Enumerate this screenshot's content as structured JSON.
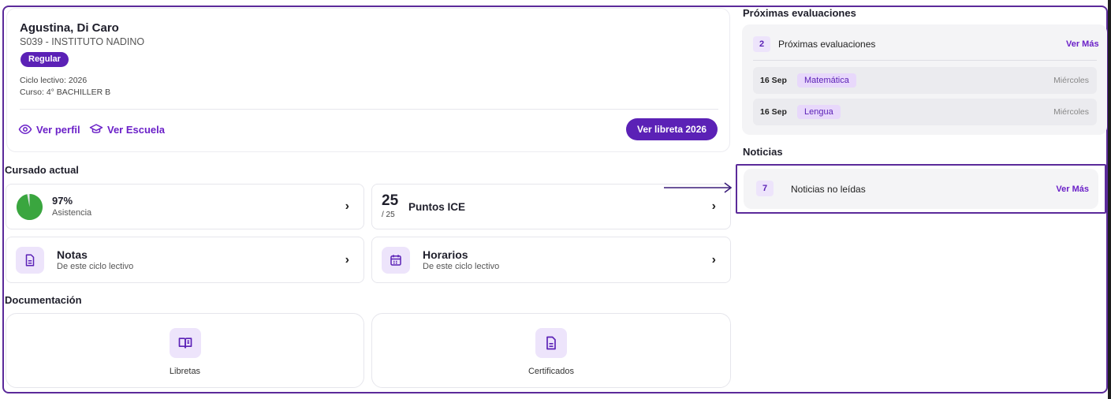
{
  "student": {
    "name": "Agustina, Di Caro",
    "school": "S039 - INSTITUTO NADINO",
    "status_badge": "Regular",
    "ciclo": "Ciclo lectivo: 2026",
    "curso": "Curso: 4° BACHILLER B",
    "link_profile": "Ver perfil",
    "link_school": "Ver Escuela",
    "btn_libreta": "Ver libreta 2026"
  },
  "cursado": {
    "title": "Cursado actual",
    "attendance": {
      "value": "97%",
      "label": "Asistencia",
      "percent": 97,
      "color": "#3aa63f"
    },
    "ice": {
      "points": "25",
      "max": "/ 25",
      "label": "Puntos ICE"
    },
    "notas": {
      "title": "Notas",
      "subtitle": "De este ciclo lectivo"
    },
    "horarios": {
      "title": "Horarios",
      "subtitle": "De este ciclo lectivo"
    }
  },
  "documentacion": {
    "title": "Documentación",
    "items": [
      {
        "label": "Libretas",
        "icon": "book-icon"
      },
      {
        "label": "Certificados",
        "icon": "document-icon"
      }
    ]
  },
  "evaluaciones": {
    "section_title": "Próximas evaluaciones",
    "count": "2",
    "panel_label": "Próximas evaluaciones",
    "ver_mas": "Ver Más",
    "items": [
      {
        "date": "16 Sep",
        "subject": "Matemática",
        "day": "Miércoles"
      },
      {
        "date": "16 Sep",
        "subject": "Lengua",
        "day": "Miércoles"
      }
    ]
  },
  "noticias": {
    "section_title": "Noticias",
    "count": "7",
    "label": "Noticias no leídas",
    "ver_mas": "Ver Más"
  },
  "colors": {
    "accent": "#5b21b6",
    "link": "#6b21c8",
    "pale": "#ede4fb"
  }
}
